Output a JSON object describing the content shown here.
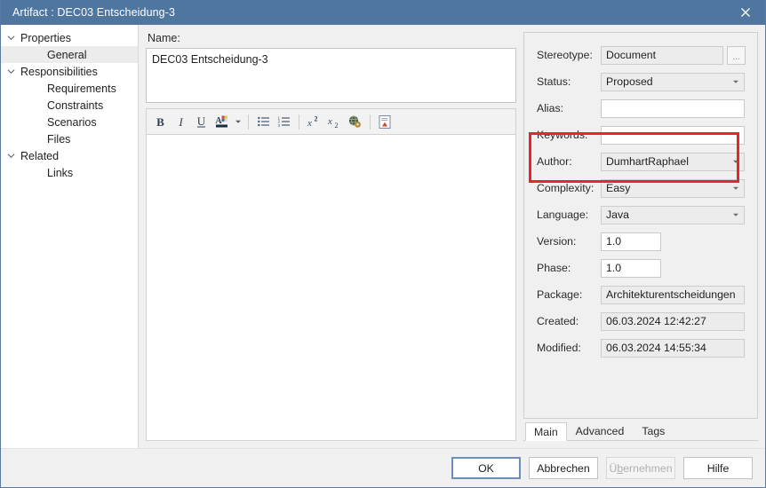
{
  "window": {
    "title": "Artifact : DEC03 Entscheidung-3",
    "close_icon": "close-icon",
    "accent_titlebar": "#4e769f",
    "annotation_color": "#e8262a"
  },
  "tree": {
    "items": [
      {
        "label": "Properties",
        "level": 0,
        "expanded": true,
        "selected": false
      },
      {
        "label": "General",
        "level": 1,
        "expanded": false,
        "selected": true
      },
      {
        "label": "Responsibilities",
        "level": 0,
        "expanded": true,
        "selected": false
      },
      {
        "label": "Requirements",
        "level": 1,
        "expanded": false,
        "selected": false
      },
      {
        "label": "Constraints",
        "level": 1,
        "expanded": false,
        "selected": false
      },
      {
        "label": "Scenarios",
        "level": 1,
        "expanded": false,
        "selected": false
      },
      {
        "label": "Files",
        "level": 1,
        "expanded": false,
        "selected": false
      },
      {
        "label": "Related",
        "level": 0,
        "expanded": true,
        "selected": false
      },
      {
        "label": "Links",
        "level": 1,
        "expanded": false,
        "selected": false
      }
    ]
  },
  "center": {
    "name_label": "Name:",
    "name_value": "DEC03 Entscheidung-3",
    "toolbar": [
      {
        "name": "bold-icon",
        "glyph": "B"
      },
      {
        "name": "italic-icon",
        "glyph": "I"
      },
      {
        "name": "underline-icon",
        "glyph": "U"
      },
      {
        "name": "font-color-icon",
        "glyph": "A"
      },
      {
        "name": "font-color-caret-icon",
        "glyph": "▾"
      },
      {
        "name": "bulleted-list-icon",
        "glyph": "≡"
      },
      {
        "name": "numbered-list-icon",
        "glyph": "≡"
      },
      {
        "name": "superscript-icon",
        "glyph": "x²"
      },
      {
        "name": "subscript-icon",
        "glyph": "x₂"
      },
      {
        "name": "hyperlink-icon",
        "glyph": "●"
      },
      {
        "name": "insert-document-icon",
        "glyph": "❐"
      }
    ],
    "editor_value": ""
  },
  "properties": {
    "fields": [
      {
        "name": "stereotype",
        "label": "Stereotype:",
        "value": "Document",
        "kind": "text-readonly",
        "has_ellipsis": true
      },
      {
        "name": "status",
        "label": "Status:",
        "value": "Proposed",
        "kind": "dropdown"
      },
      {
        "name": "alias",
        "label": "Alias:",
        "value": "",
        "kind": "text"
      },
      {
        "name": "keywords",
        "label": "Keywords:",
        "value": "",
        "kind": "text"
      },
      {
        "name": "author",
        "label": "Author:",
        "value": "DumhartRaphael",
        "kind": "dropdown"
      },
      {
        "name": "complexity",
        "label": "Complexity:",
        "value": "Easy",
        "kind": "dropdown"
      },
      {
        "name": "language",
        "label": "Language:",
        "value": "Java",
        "kind": "dropdown"
      },
      {
        "name": "version",
        "label": "Version:",
        "value": "1.0",
        "kind": "text-small"
      },
      {
        "name": "phase",
        "label": "Phase:",
        "value": "1.0",
        "kind": "text-small"
      }
    ],
    "bottom_fields": [
      {
        "name": "package",
        "label": "Package:",
        "value": "Architekturentscheidungen",
        "kind": "text-readonly"
      },
      {
        "name": "created",
        "label": "Created:",
        "value": "06.03.2024 12:42:27",
        "kind": "text-readonly"
      },
      {
        "name": "modified",
        "label": "Modified:",
        "value": "06.03.2024 14:55:34",
        "kind": "text-readonly"
      }
    ],
    "ellipsis_label": "...",
    "tabs": [
      {
        "label": "Main",
        "active": true
      },
      {
        "label": "Advanced",
        "active": false
      },
      {
        "label": "Tags",
        "active": false
      }
    ]
  },
  "footer": {
    "buttons": [
      {
        "name": "ok-button",
        "label": "OK",
        "state": "default-focus"
      },
      {
        "name": "cancel-button",
        "label": "Abbrechen",
        "state": "normal"
      },
      {
        "name": "apply-button",
        "label": "Übernehmen",
        "state": "disabled"
      },
      {
        "name": "help-button",
        "label": "Hilfe",
        "state": "normal"
      }
    ]
  }
}
